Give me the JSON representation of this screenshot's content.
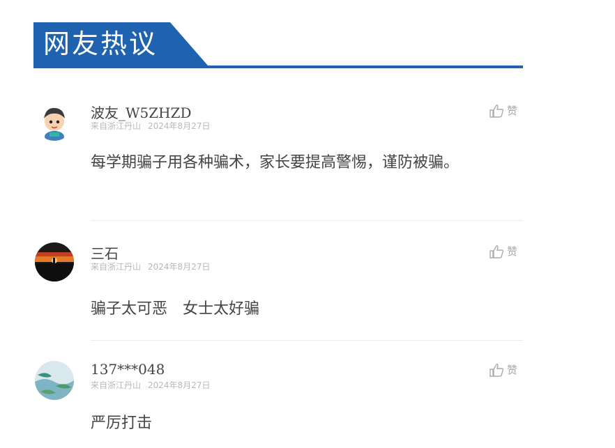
{
  "section": {
    "title": "网友热议"
  },
  "colors": {
    "accent": "#1f63b0",
    "meta": "#b8b8b8"
  },
  "comments": [
    {
      "username": "波友_W5ZHZD",
      "location": "来自浙江丹山",
      "date": "2024年8月27日",
      "like_label": "赞",
      "avatar": "cartoon-boy-avatar",
      "text": "每学期骗子用各种骗术，家长要提高警惕，谨防被骗。"
    },
    {
      "username": "三石",
      "location": "来自浙江丹山",
      "date": "2024年8月27日",
      "like_label": "赞",
      "avatar": "sunset-avatar",
      "text": "骗子太可恶　女士太好骗"
    },
    {
      "username": "137***048",
      "location": "来自浙江丹山",
      "date": "2024年8月27日",
      "like_label": "赞",
      "avatar": "landscape-avatar",
      "text": "严厉打击"
    }
  ]
}
